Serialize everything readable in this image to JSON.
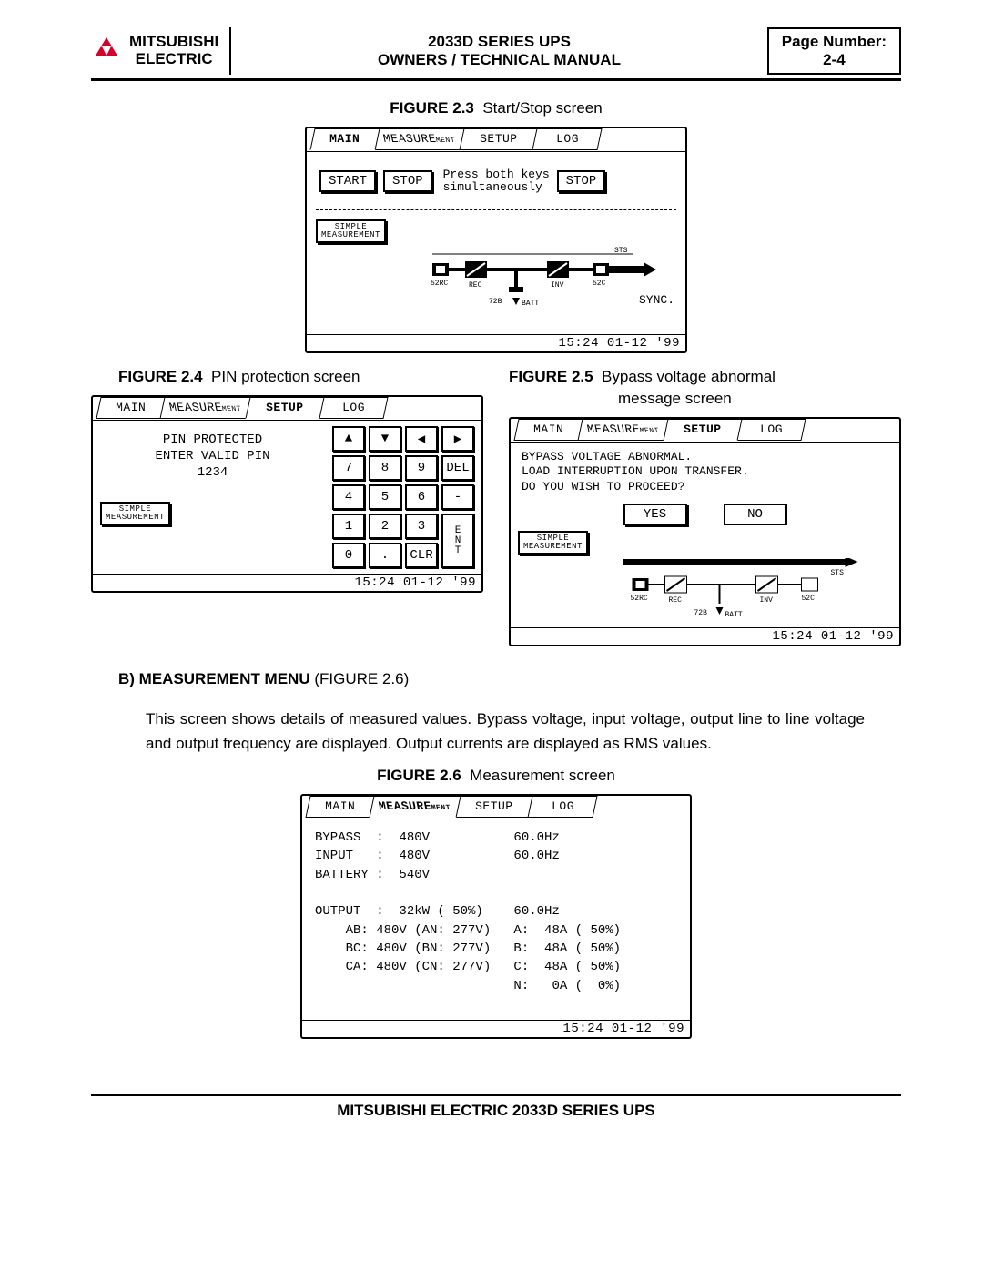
{
  "header": {
    "brand_line1": "MITSUBISHI",
    "brand_line2": "ELECTRIC",
    "title_line1": "2033D SERIES UPS",
    "title_line2": "OWNERS / TECHNICAL MANUAL",
    "page_label": "Page Number:",
    "page_value": "2-4"
  },
  "tabs": {
    "main": "MAIN",
    "measure": "MEASURE",
    "ment": "MENT",
    "setup": "SETUP",
    "log": "LOG"
  },
  "timestamp": "15:24 01-12 '99",
  "simple_btn_l1": "SIMPLE",
  "simple_btn_l2": "MEASUREMENT",
  "fig23": {
    "label": "FIGURE 2.3",
    "caption": "Start/Stop screen",
    "start": "START",
    "stop": "STOP",
    "hint_l1": "Press both keys",
    "hint_l2": "simultaneously",
    "stop2": "STOP",
    "dia": {
      "l52rc": "52RC",
      "lrec": "REC",
      "l72b": "72B",
      "lbatt": "BATT",
      "linv": "INV",
      "l52c": "52C",
      "lsts": "STS"
    },
    "sync": "SYNC."
  },
  "fig24": {
    "label": "FIGURE 2.4",
    "caption": "PIN protection screen",
    "msg_l1": "PIN PROTECTED",
    "msg_l2": "ENTER VALID PIN",
    "msg_l3": "1234",
    "keys": [
      "▲",
      "▼",
      "◀",
      "▶",
      "7",
      "8",
      "9",
      "DEL",
      "4",
      "5",
      "6",
      "-",
      "1",
      "2",
      "3",
      "E\nN\nT",
      "0",
      ".",
      "CLR"
    ]
  },
  "fig25": {
    "label": "FIGURE 2.5",
    "caption_l1": "Bypass voltage abnormal",
    "caption_l2": "message screen",
    "msg_l1": "BYPASS VOLTAGE ABNORMAL.",
    "msg_l2": "LOAD INTERRUPTION UPON TRANSFER.",
    "msg_l3": "DO YOU WISH TO PROCEED?",
    "yes": "YES",
    "no": "NO"
  },
  "sectionB": {
    "head_prefix": "B)   MEASUREMENT MENU",
    "head_suffix": " (FIGURE 2.6)",
    "para": "This screen shows details of measured values. Bypass voltage, input voltage, output line to line voltage and output frequency are displayed. Output currents are displayed as RMS values."
  },
  "fig26": {
    "label": "FIGURE 2.6",
    "caption": "Measurement screen",
    "rows": [
      "BYPASS  :  480V           60.0Hz",
      "INPUT   :  480V           60.0Hz",
      "BATTERY :  540V",
      "",
      "OUTPUT  :  32kW ( 50%)    60.0Hz",
      "    AB: 480V (AN: 277V)   A:  48A ( 50%)",
      "    BC: 480V (BN: 277V)   B:  48A ( 50%)",
      "    CA: 480V (CN: 277V)   C:  48A ( 50%)",
      "                          N:   0A (  0%)"
    ]
  },
  "footer": "MITSUBISHI ELECTRIC 2033D SERIES UPS"
}
